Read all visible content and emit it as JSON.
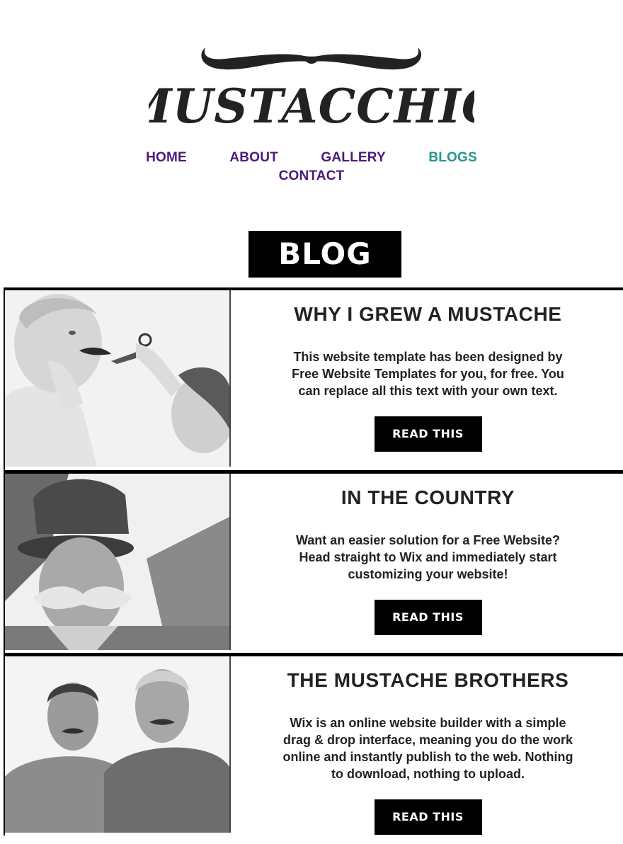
{
  "logo": {
    "text": "MUSTACCHIO"
  },
  "nav": {
    "items": [
      {
        "label": "HOME"
      },
      {
        "label": "ABOUT"
      },
      {
        "label": "GALLERY"
      },
      {
        "label": "BLOGS"
      },
      {
        "label": "CONTACT"
      }
    ],
    "active": "BLOGS",
    "link_color": "#4b1a7a",
    "active_color": "#24958f"
  },
  "page_title": "BLOG",
  "posts": [
    {
      "title": "WHY I GREW A MUSTACHE",
      "text": "This website template has been designed by Free Website Templates for you, for free. You can replace all this text with your own text.",
      "button": "READ THIS",
      "image_icon": "child-trimming-grandpa-mustache-photo"
    },
    {
      "title": "IN THE COUNTRY",
      "text": "Want an easier solution for a Free Website? Head straight to Wix and immediately start customizing your website!",
      "button": "READ THIS",
      "image_icon": "old-man-with-hat-photo"
    },
    {
      "title": "THE MUSTACHE BROTHERS",
      "text": "Wix is an online website builder with a simple drag & drop interface, meaning you do the work online and instantly publish to the web. Nothing to download, nothing to upload.",
      "button": "READ THIS",
      "image_icon": "two-smiling-men-photo"
    }
  ]
}
